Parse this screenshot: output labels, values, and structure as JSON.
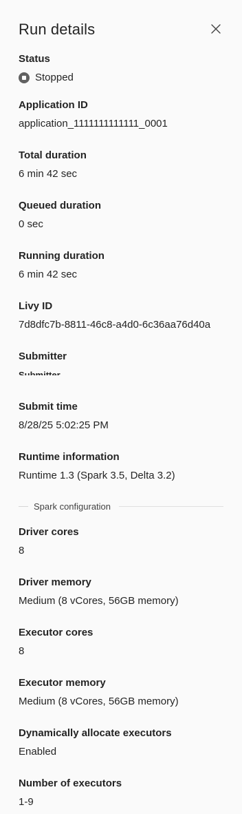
{
  "panel": {
    "title": "Run details"
  },
  "status": {
    "label": "Status",
    "value": "Stopped"
  },
  "application_id": {
    "label": "Application ID",
    "value": "application_1111111111111_0001"
  },
  "total_duration": {
    "label": "Total duration",
    "value": "6 min 42 sec"
  },
  "queued_duration": {
    "label": "Queued duration",
    "value": "0 sec"
  },
  "running_duration": {
    "label": "Running duration",
    "value": "6 min 42 sec"
  },
  "livy_id": {
    "label": "Livy ID",
    "value": "7d8dfc7b-8811-46c8-a4d0-6c36aa76d40a"
  },
  "submitter": {
    "label": "Submitter",
    "value": "Submitter"
  },
  "submit_time": {
    "label": "Submit time",
    "value": "8/28/25 5:02:25 PM"
  },
  "runtime_information": {
    "label": "Runtime information",
    "value": "Runtime 1.3 (Spark 3.5, Delta 3.2)"
  },
  "spark_configuration": {
    "divider_label": "Spark configuration"
  },
  "driver_cores": {
    "label": "Driver cores",
    "value": "8"
  },
  "driver_memory": {
    "label": "Driver memory",
    "value": "Medium (8 vCores, 56GB memory)"
  },
  "executor_cores": {
    "label": "Executor cores",
    "value": "8"
  },
  "executor_memory": {
    "label": "Executor memory",
    "value": "Medium (8 vCores, 56GB memory)"
  },
  "dynamic_allocation": {
    "label": "Dynamically allocate executors",
    "value": "Enabled"
  },
  "number_of_executors": {
    "label": "Number of executors",
    "value": "1-9"
  },
  "colors": {
    "background": "#fafafa",
    "text": "#242424",
    "status_icon": "#616161"
  }
}
